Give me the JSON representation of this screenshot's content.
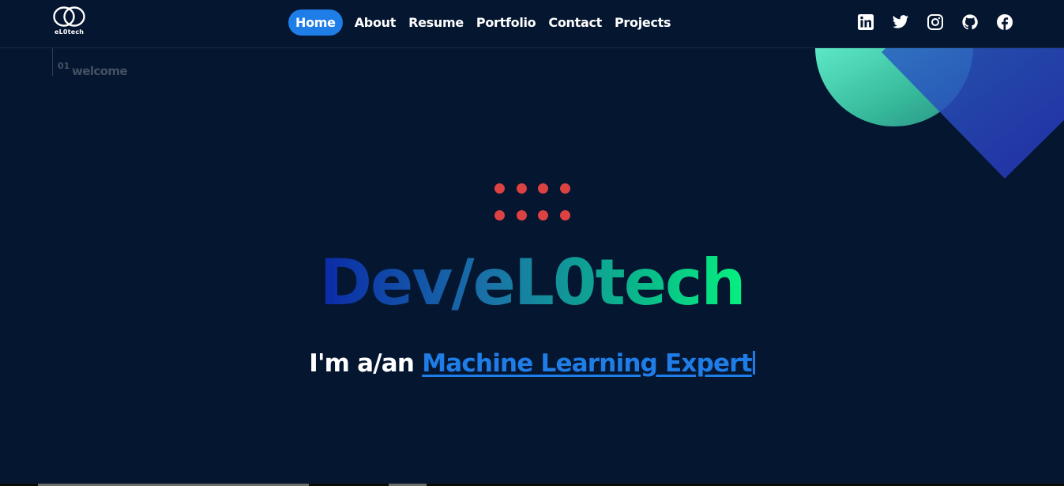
{
  "brand": {
    "logo_text": "eL0tech",
    "logo_icon": "infinity-loop-logo"
  },
  "nav": {
    "items": [
      {
        "label": "Home",
        "active": true
      },
      {
        "label": "About",
        "active": false
      },
      {
        "label": "Resume",
        "active": false
      },
      {
        "label": "Portfolio",
        "active": false
      },
      {
        "label": "Contact",
        "active": false
      },
      {
        "label": "Projects",
        "active": false
      }
    ]
  },
  "socials": [
    {
      "icon": "linkedin-icon"
    },
    {
      "icon": "twitter-icon"
    },
    {
      "icon": "instagram-icon"
    },
    {
      "icon": "github-icon"
    },
    {
      "icon": "facebook-icon"
    }
  ],
  "section": {
    "number": "01",
    "title": "welcome"
  },
  "hero": {
    "title": "Dev/eL0tech",
    "tagline_prefix": "I'm a/an",
    "role": "Machine Learning Expert"
  },
  "colors": {
    "background": "#051630",
    "accent": "#1f7de8",
    "dots": "#dc4242",
    "gradient_start": "#0b2aa8",
    "gradient_end": "#05f07f"
  }
}
